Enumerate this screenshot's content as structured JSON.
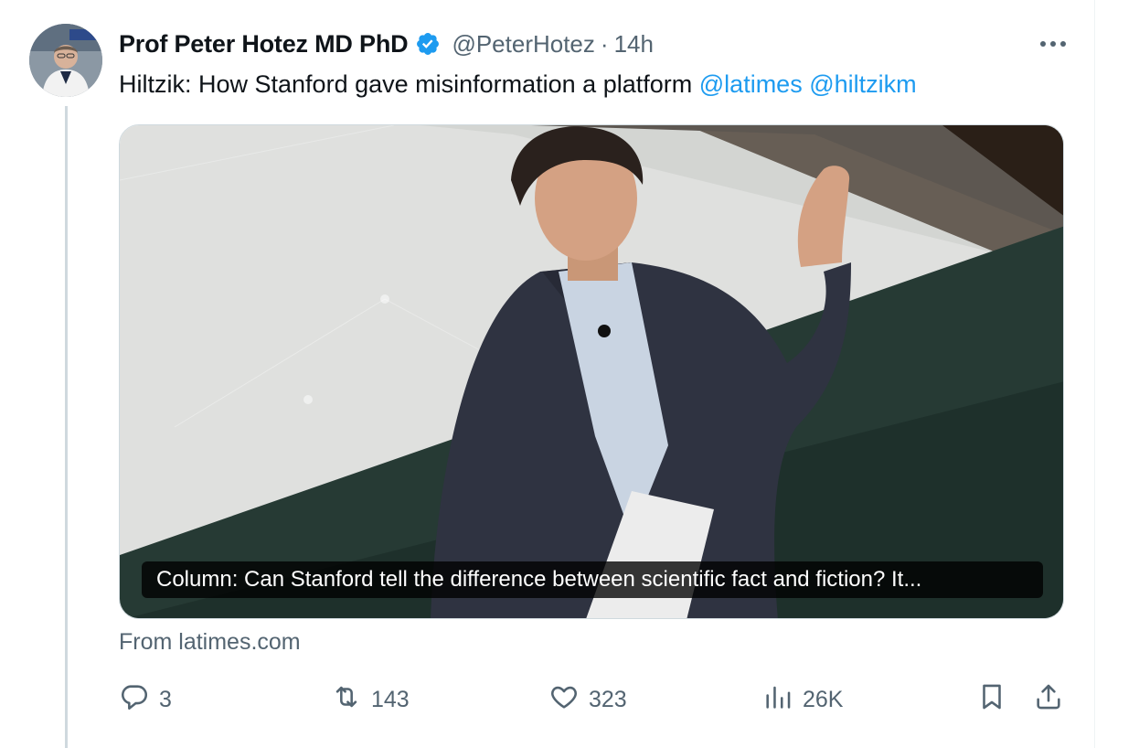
{
  "tweet": {
    "author_name": "Prof Peter Hotez MD PhD",
    "author_handle": "@PeterHotez",
    "separator": "·",
    "time": "14h",
    "text": "Hiltzik: How Stanford gave misinformation a platform",
    "mentions": [
      "@latimes",
      "@hiltzikm"
    ],
    "verified": true
  },
  "card": {
    "caption": "Column: Can Stanford tell the difference between scientific fact and fiction? It...",
    "source": "From latimes.com"
  },
  "actions": {
    "replies": "3",
    "reposts": "143",
    "likes": "323",
    "views": "26K"
  },
  "icons": {
    "verified": "verified-badge-icon",
    "more": "more-icon",
    "reply": "reply-icon",
    "repost": "repost-icon",
    "like": "like-icon",
    "views": "views-icon",
    "bookmark": "bookmark-icon",
    "share": "share-icon"
  },
  "colors": {
    "accent": "#1d9bf0",
    "secondary_text": "#536471",
    "primary_text": "#0f1419"
  }
}
